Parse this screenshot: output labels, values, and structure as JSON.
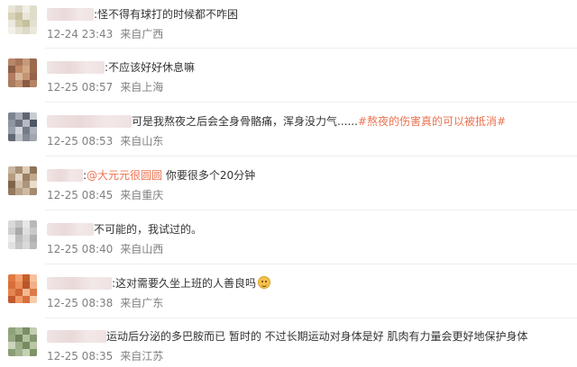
{
  "comments": [
    {
      "text": ":怪不得有球打的时候都不咋困",
      "time": "12-24 23:43",
      "location": "来自广西",
      "avatar_colors": [
        "#e8e4d6",
        "#dcd8c6",
        "#f0eee6",
        "#e2ddc9",
        "#d8d2b8",
        "#c9c2a2",
        "#e9e6d9",
        "#e0dccb",
        "#ece9dd",
        "#d4ce b0",
        "#c7c09e",
        "#e5e1d2",
        "#f2f0e8",
        "#e7e4d6",
        "#dedac8",
        "#ebe8dc"
      ]
    },
    {
      "text": ":不应该好好休息嘛",
      "time": "12-25 08:57",
      "location": "来自上海",
      "avatar_colors": [
        "#b9876a",
        "#a8745a",
        "#c59a7c",
        "#9c6a50",
        "#8e5e45",
        "#c08a66",
        "#d2a888",
        "#a06a4c",
        "#b27c5e",
        "#d8b69a",
        "#c49474",
        "#94634a",
        "#a97a5e",
        "#bf9272",
        "#8a5a42",
        "#b38464"
      ]
    },
    {
      "text": "可是我熬夜之后会全身骨骼痛，浑身没力气......",
      "hashtag": "#熬夜的伤害真的可以被抵消#",
      "time": "12-25 08:53",
      "location": "来自山东",
      "avatar_colors": [
        "#7c8491",
        "#a7adb7",
        "#5f6672",
        "#c9ccd2",
        "#8f96a2",
        "#6b7380",
        "#b5b9c1",
        "#4f5664",
        "#9aa0ab",
        "#d3d5da",
        "#747b88",
        "#adb2bb",
        "#626977",
        "#bcc0c7",
        "#848b97",
        "#a1a6b0"
      ]
    },
    {
      "prefix": ":",
      "mention": "@大元元很圆圆",
      "text": " 你要很多个20分钟",
      "time": "12-25 08:45",
      "location": "来自重庆",
      "avatar_colors": [
        "#c9b6a0",
        "#a88f74",
        "#dccbb7",
        "#8f7458",
        "#b59c80",
        "#e3d5c3",
        "#9b8064",
        "#c1a98e",
        "#7e644b",
        "#d2bfa9",
        "#ad947a",
        "#e8dccd",
        "#95795d",
        "#bba287",
        "#cfbaa2",
        "#a48a6f"
      ]
    },
    {
      "text": "不可能的，我试过的。",
      "time": "12-25 08:40",
      "location": "来自山西",
      "avatar_colors": [
        "#d9d9d9",
        "#c4c4c4",
        "#e6e6e6",
        "#b8b8b8",
        "#cfcfcf",
        "#a9a9a9",
        "#dedede",
        "#c9c9c9",
        "#ececec",
        "#bdbdbd",
        "#d4d4d4",
        "#b0b0b0",
        "#e1e1e1",
        "#c6c6c6",
        "#dadada",
        "#bababa"
      ]
    },
    {
      "text": ":这对需要久坐上班的人善良吗",
      "emoji": "smile-emoji",
      "time": "12-25 08:38",
      "location": "来自广东",
      "avatar_colors": [
        "#e07a44",
        "#f0a070",
        "#c85e2c",
        "#f6c29c",
        "#d86f3a",
        "#eb8f5a",
        "#b9552a",
        "#f2b086",
        "#e58550",
        "#cf6634",
        "#f4b892",
        "#dc7a48",
        "#c45a2e",
        "#ee9a66",
        "#d77040",
        "#f8caa8"
      ]
    },
    {
      "text": "运动后分泌的多巴胺而已 暂时的 不过长期运动对身体是好  肌肉有力量会更好地保护身体",
      "time": "12-25 08:35",
      "location": "来自江苏",
      "avatar_colors": [
        "#8fa27a",
        "#a9b894",
        "#7a8e66",
        "#c2cdb1",
        "#96a882",
        "#6e8259",
        "#b3c19f",
        "#84986e",
        "#cbd4bc",
        "#9dae89",
        "#778b62",
        "#bac6a7",
        "#8a9d75",
        "#a3b38e",
        "#c6d0b6",
        "#7f9369"
      ]
    }
  ]
}
